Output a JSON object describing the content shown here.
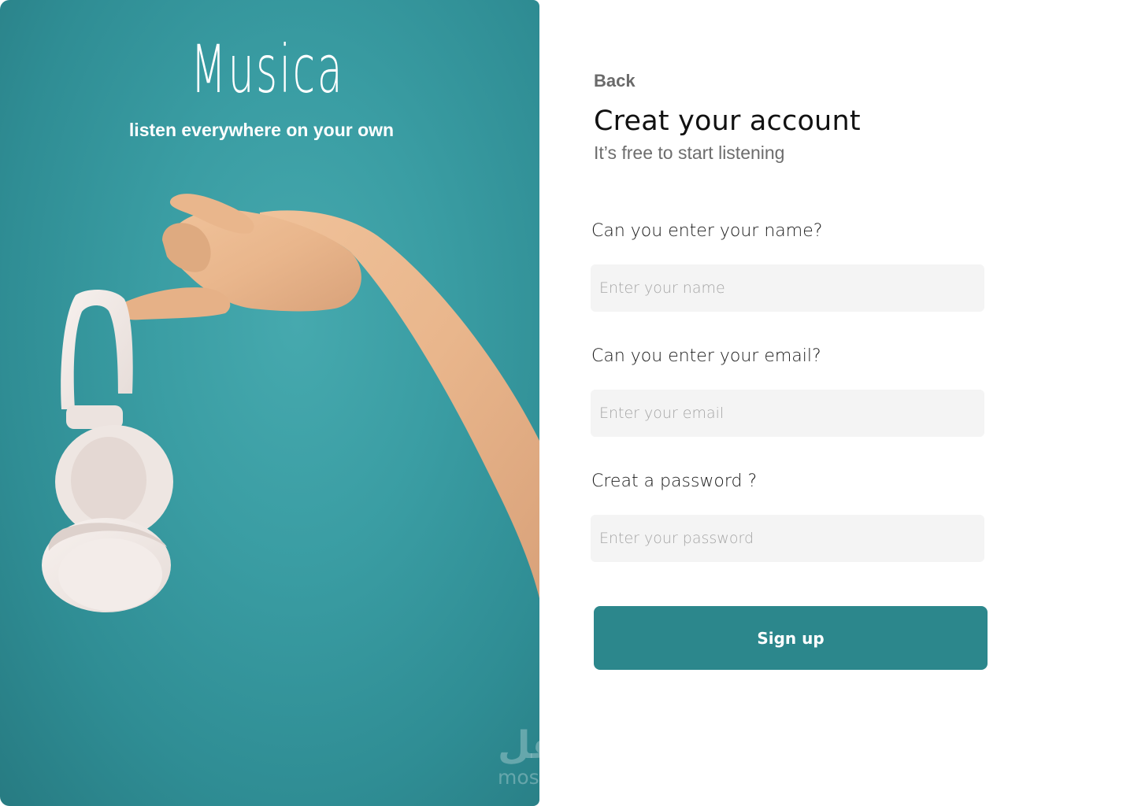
{
  "brand": {
    "name": "Musica",
    "tagline": "listen everywhere on your own"
  },
  "form": {
    "back_label": "Back",
    "title": "Creat your account",
    "subtitle": "It’s free to start listening",
    "fields": [
      {
        "label": "Can you enter your name?",
        "placeholder": "Enter your name",
        "value": ""
      },
      {
        "label": "Can you enter your email?",
        "placeholder": "Enter your email",
        "value": ""
      },
      {
        "label": "Creat a password ?",
        "placeholder": "Enter your password",
        "value": ""
      }
    ],
    "submit_label": "Sign up"
  },
  "watermark": {
    "arabic": "مستقل",
    "latin": "mostaql.com"
  },
  "colors": {
    "hero_teal": "#3a9da3",
    "button": "#2c878c",
    "input_bg": "#f4f4f4",
    "headphones": "#f2ebe8",
    "skin": "#e8b98f"
  },
  "icons": {
    "illustration": "hand-holding-headphones"
  }
}
